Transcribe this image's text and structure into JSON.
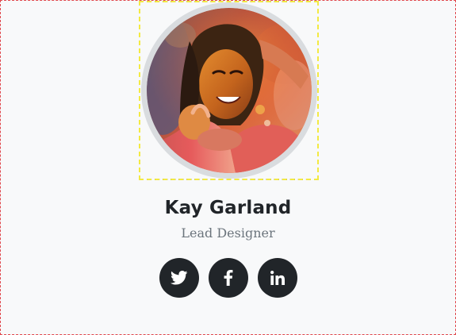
{
  "team_member": {
    "name": "Kay Garland",
    "title": "Lead Designer",
    "photo_alt": "Kay Garland"
  },
  "socials": [
    {
      "icon": "twitter-icon"
    },
    {
      "icon": "facebook-icon"
    },
    {
      "icon": "linkedin-icon"
    }
  ],
  "colors": {
    "background": "#f8f9fa",
    "button": "#212529",
    "name_text": "#212529",
    "title_text": "#6c757d",
    "avatar_ring": "#d9dcdf"
  }
}
